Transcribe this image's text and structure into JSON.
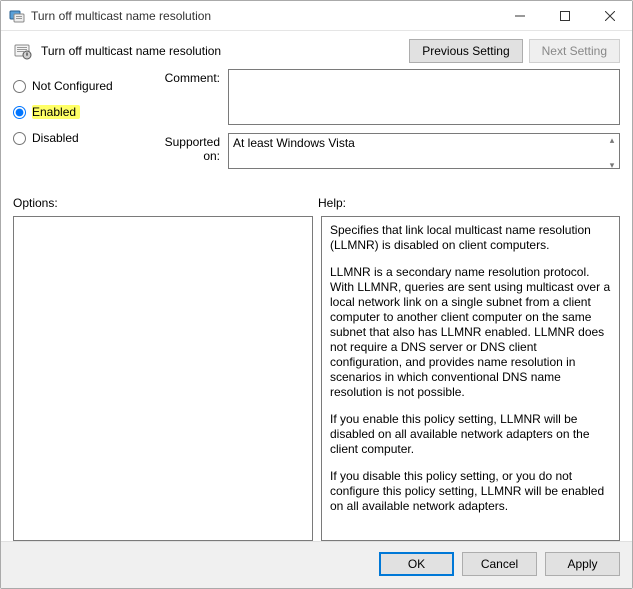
{
  "window": {
    "title": "Turn off multicast name resolution"
  },
  "header": {
    "policy_title": "Turn off multicast name resolution",
    "prev_label": "Previous Setting",
    "next_label": "Next Setting"
  },
  "state": {
    "not_configured_label": "Not Configured",
    "enabled_label": "Enabled",
    "disabled_label": "Disabled",
    "selected": "enabled"
  },
  "fields": {
    "comment_label": "Comment:",
    "comment_value": "",
    "supported_label": "Supported on:",
    "supported_value": "At least Windows Vista"
  },
  "labels": {
    "options": "Options:",
    "help": "Help:"
  },
  "options_content": "",
  "help": {
    "p1": "Specifies that link local multicast name resolution (LLMNR) is disabled on client computers.",
    "p2": "LLMNR is a secondary name resolution protocol. With LLMNR, queries are sent using multicast over a local network link on a single subnet from a client computer to another client computer on the same subnet that also has LLMNR enabled. LLMNR does not require a DNS server or DNS client configuration, and provides name resolution in scenarios in which conventional DNS name resolution is not possible.",
    "p3": "If you enable this policy setting, LLMNR will be disabled on all available network adapters on the client computer.",
    "p4": "If you disable this policy setting, or you do not configure this policy setting, LLMNR will be enabled on all available network adapters."
  },
  "footer": {
    "ok": "OK",
    "cancel": "Cancel",
    "apply": "Apply"
  }
}
